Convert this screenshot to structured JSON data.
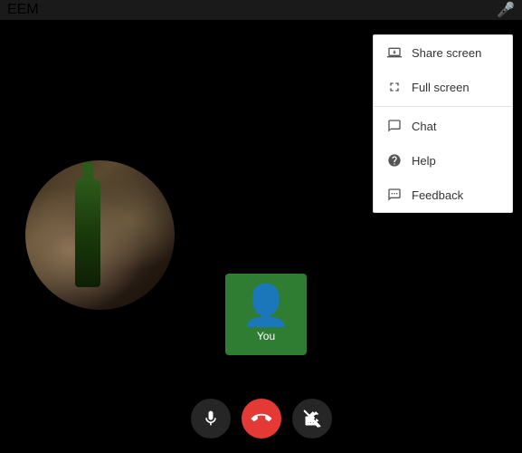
{
  "titleBar": {
    "title": "EEM",
    "micIcon": "🎤"
  },
  "youTile": {
    "label": "You"
  },
  "controls": {
    "micBtn": "🎤",
    "hangupBtn": "📞",
    "videoBtn": "🎥"
  },
  "contextMenu": {
    "items": [
      {
        "id": "share-screen",
        "label": "Share screen",
        "icon": "share-screen-icon"
      },
      {
        "id": "full-screen",
        "label": "Full screen",
        "icon": "fullscreen-icon"
      },
      {
        "id": "chat",
        "label": "Chat",
        "icon": "chat-icon"
      },
      {
        "id": "help",
        "label": "Help",
        "icon": "help-icon"
      },
      {
        "id": "feedback",
        "label": "Feedback",
        "icon": "feedback-icon"
      }
    ]
  }
}
